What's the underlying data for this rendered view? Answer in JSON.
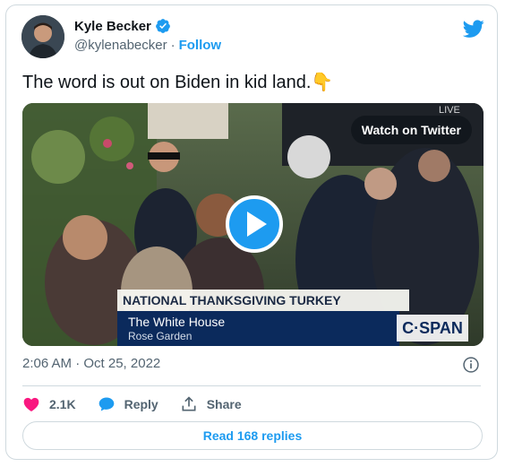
{
  "author": {
    "name": "Kyle Becker",
    "handle": "@kylenabecker",
    "separator": "·",
    "follow_label": "Follow",
    "verified": true
  },
  "tweet": {
    "text": "The word is out on Biden in kid land.👇",
    "timestamp": "2:06 AM · Oct 25, 2022"
  },
  "media": {
    "watch_label": "Watch on Twitter",
    "live_tag": "LIVE",
    "banner_title": "NATIONAL THANKSGIVING TURKEY PARDONING",
    "banner_line1": "The White House",
    "banner_line2": "Rose Garden",
    "network": "C·SPAN"
  },
  "actions": {
    "likes": "2.1K",
    "reply_label": "Reply",
    "share_label": "Share"
  },
  "footer": {
    "read_replies": "Read 168 replies"
  },
  "colors": {
    "accent": "#1d9bf0",
    "like": "#f91880",
    "text_secondary": "#536471"
  },
  "icons": [
    "verified-badge-icon",
    "twitter-bird-icon",
    "play-icon",
    "info-icon",
    "heart-icon",
    "reply-bubble-icon",
    "share-icon"
  ]
}
